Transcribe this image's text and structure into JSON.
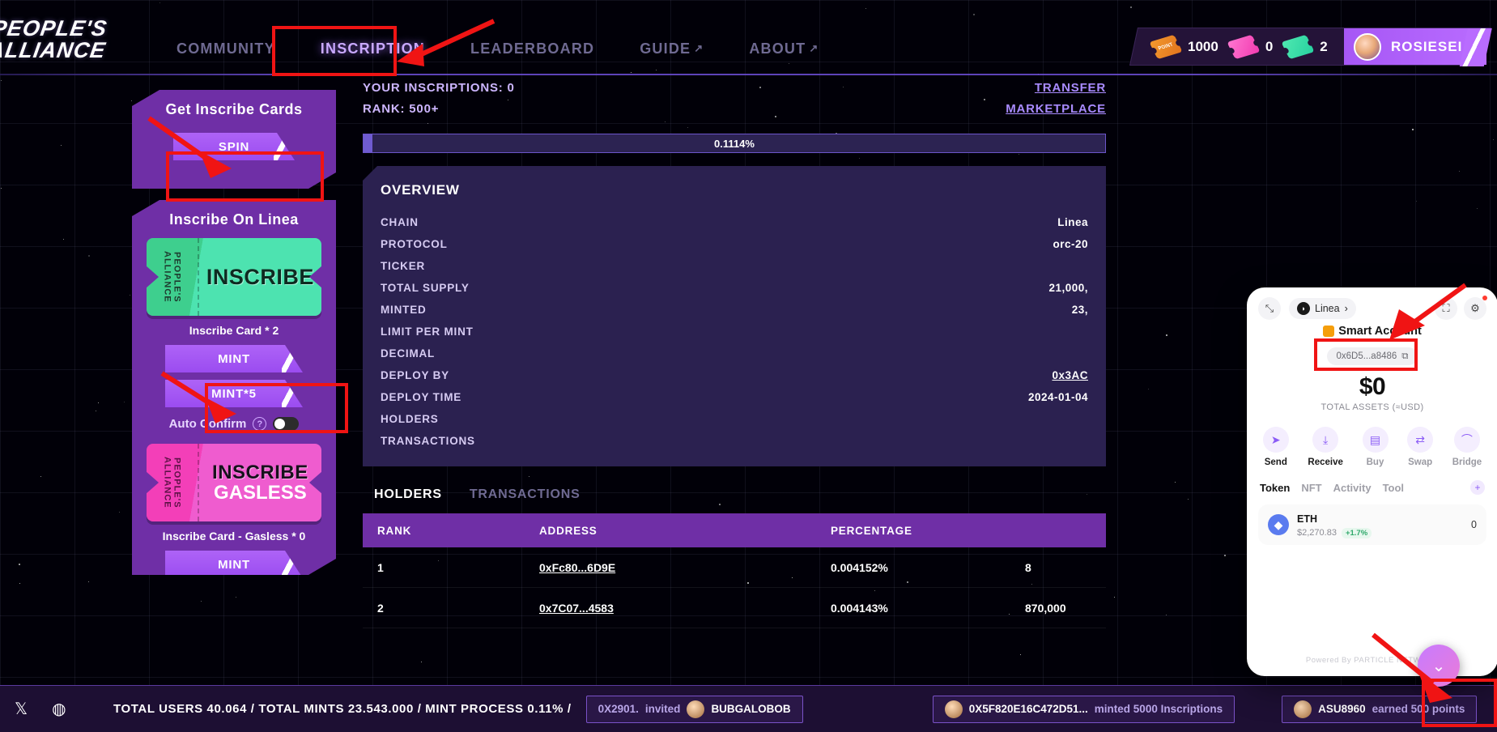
{
  "header": {
    "logo_line1": "PEOPLE'S",
    "logo_line2": "ALLIANCE",
    "nav": [
      {
        "label": "COMMUNITY",
        "external": false,
        "active": false
      },
      {
        "label": "INSCRIPTION",
        "external": false,
        "active": true
      },
      {
        "label": "LEADERBOARD",
        "external": false,
        "active": false
      },
      {
        "label": "GUIDE",
        "external": true,
        "active": false
      },
      {
        "label": "ABOUT",
        "external": true,
        "active": false
      }
    ],
    "account": {
      "point_ticket_label": "POINT",
      "points": "1000",
      "pink_ticket_label": "INSCRIBE GASLESS",
      "pink_count": "0",
      "green_ticket_label": "INSCRIBE",
      "green_count": "2",
      "username": "ROSIESEI"
    }
  },
  "sidebar": {
    "spin_card": {
      "title": "Get Inscribe Cards",
      "spin_label": "SPIN"
    },
    "inscribe_card": {
      "title": "Inscribe On Linea",
      "ticket_brand_line1": "PEOPLE'S",
      "ticket_brand_line2": "ALLIANCE",
      "ticket_label": "INSCRIBE",
      "count_label": "Inscribe Card * 2",
      "mint_label": "MINT",
      "mint5_label": "MINT*5",
      "auto_confirm_label": "Auto Confirm",
      "auto_confirm_help": "?",
      "auto_confirm_on": false,
      "gasless_ticket_line1": "INSCRIBE",
      "gasless_ticket_line2": "GASLESS",
      "gasless_count_label": "Inscribe Card - Gasless * 0",
      "gasless_mint_label": "MINT"
    }
  },
  "main": {
    "your_inscriptions": "YOUR INSCRIPTIONS: 0",
    "rank": "RANK: 500+",
    "links": [
      {
        "label": "TRANSFER"
      },
      {
        "label": "MARKETPLACE"
      }
    ],
    "progress": {
      "percent_label": "0.1114%",
      "fill_percent": 1.2
    },
    "overview": {
      "title": "OVERVIEW",
      "rows": [
        {
          "key": "CHAIN",
          "value": "Linea",
          "link": false
        },
        {
          "key": "PROTOCOL",
          "value": "orc-20",
          "link": false
        },
        {
          "key": "TICKER",
          "value": "",
          "link": false
        },
        {
          "key": "TOTAL SUPPLY",
          "value": "21,000,",
          "link": false
        },
        {
          "key": "MINTED",
          "value": "23,",
          "link": false
        },
        {
          "key": "LIMIT PER MINT",
          "value": "",
          "link": false
        },
        {
          "key": "DECIMAL",
          "value": "",
          "link": false
        },
        {
          "key": "DEPLOY BY",
          "value": "0x3AC",
          "link": true
        },
        {
          "key": "DEPLOY TIME",
          "value": "2024-01-04",
          "link": false
        },
        {
          "key": "HOLDERS",
          "value": "",
          "link": false
        },
        {
          "key": "TRANSACTIONS",
          "value": "",
          "link": false
        }
      ]
    },
    "tabs": [
      {
        "label": "HOLDERS",
        "active": true
      },
      {
        "label": "TRANSACTIONS",
        "active": false
      }
    ],
    "table": {
      "columns": [
        "RANK",
        "ADDRESS",
        "PERCENTAGE",
        ""
      ],
      "rows": [
        {
          "rank": "1",
          "address": "0xFc80...6D9E",
          "percentage": "0.004152%",
          "amount": "8"
        },
        {
          "rank": "2",
          "address": "0x7C07...4583",
          "percentage": "0.004143%",
          "amount": "870,000"
        }
      ]
    }
  },
  "wallet": {
    "expand_icon": "expand-icon",
    "chain_label": "Linea",
    "scan_icon": "scan-icon",
    "settings_icon": "gear-icon",
    "account_title": "Smart Account",
    "address": "0x6D5...a8486",
    "copy_icon": "copy-icon",
    "total_assets": "$0",
    "total_assets_label": "TOTAL ASSETS (≈USD)",
    "actions": [
      {
        "label": "Send",
        "icon": "send-icon",
        "enabled": true
      },
      {
        "label": "Receive",
        "icon": "receive-icon",
        "enabled": true
      },
      {
        "label": "Buy",
        "icon": "card-icon",
        "enabled": false
      },
      {
        "label": "Swap",
        "icon": "swap-icon",
        "enabled": false
      },
      {
        "label": "Bridge",
        "icon": "bridge-icon",
        "enabled": false
      }
    ],
    "tabs": [
      {
        "label": "Token",
        "active": true
      },
      {
        "label": "NFT",
        "active": false
      },
      {
        "label": "Activity",
        "active": false
      },
      {
        "label": "Tool",
        "active": false
      }
    ],
    "add_token_label": "+",
    "tokens": [
      {
        "symbol": "ETH",
        "price": "$2,270.83",
        "change": "+1.7%",
        "amount": "0"
      }
    ],
    "powered_by": "Powered By  PARTICLE NETWORK"
  },
  "fab": {
    "icon": "chevron-down-icon"
  },
  "bottombar": {
    "socials": [
      "x-icon",
      "discord-icon"
    ],
    "stats": "TOTAL USERS 40.064  /  TOTAL MINTS 23.543.000  /  MINT PROCESS 0.11%  /",
    "invite_chip": {
      "code": "0X2901.",
      "action": "invited",
      "user": "BUBGALOBOB"
    },
    "event_chip": {
      "address": "0X5F820E16C472D51...",
      "text": "minted 5000 Inscriptions"
    },
    "earn_chip": {
      "user": "ASU8960",
      "text": "earned 500 points"
    }
  },
  "annotations": {
    "color": "#f01414",
    "boxes": [
      {
        "name": "inscription-nav-highlight"
      },
      {
        "name": "spin-button-highlight"
      },
      {
        "name": "mint-button-highlight"
      },
      {
        "name": "wallet-address-highlight"
      },
      {
        "name": "fab-highlight"
      }
    ]
  }
}
